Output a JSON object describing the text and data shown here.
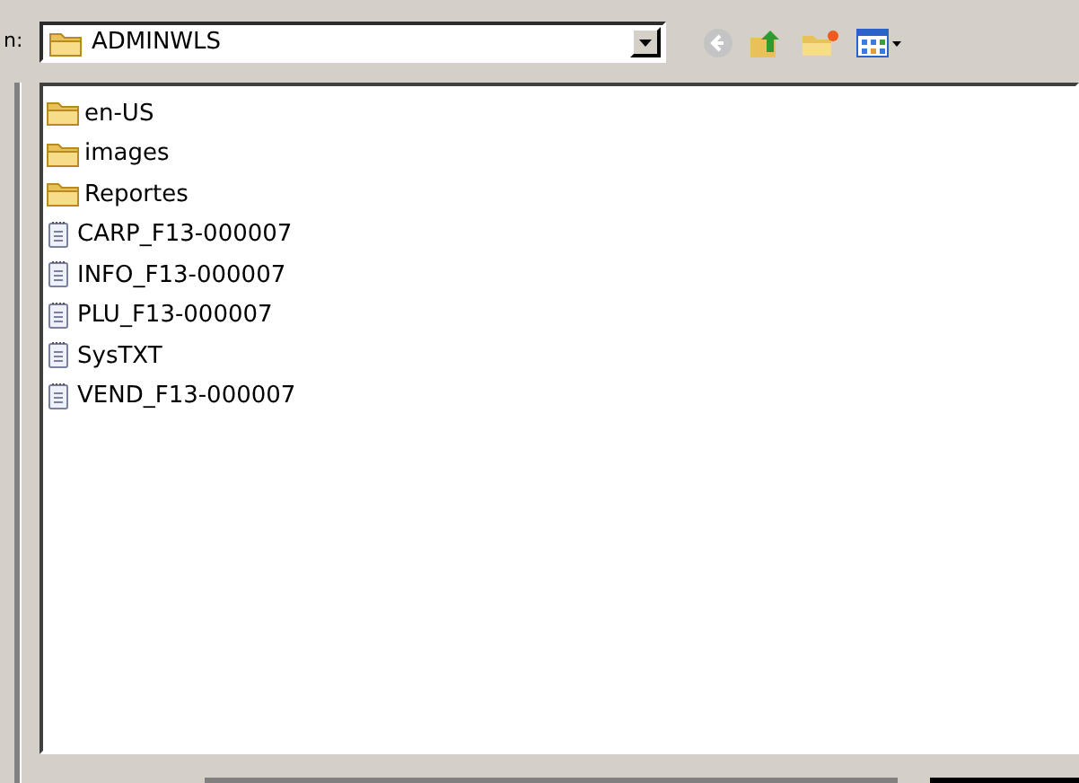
{
  "look_in": {
    "label": "n:",
    "value": "ADMINWLS"
  },
  "files": [
    {
      "name": "en-US",
      "kind": "folder"
    },
    {
      "name": "images",
      "kind": "folder"
    },
    {
      "name": "Reportes",
      "kind": "folder"
    },
    {
      "name": "CARP_F13-000007",
      "kind": "file"
    },
    {
      "name": "INFO_F13-000007",
      "kind": "file"
    },
    {
      "name": "PLU_F13-000007",
      "kind": "file"
    },
    {
      "name": "SysTXT",
      "kind": "file"
    },
    {
      "name": "VEND_F13-000007",
      "kind": "file"
    }
  ]
}
